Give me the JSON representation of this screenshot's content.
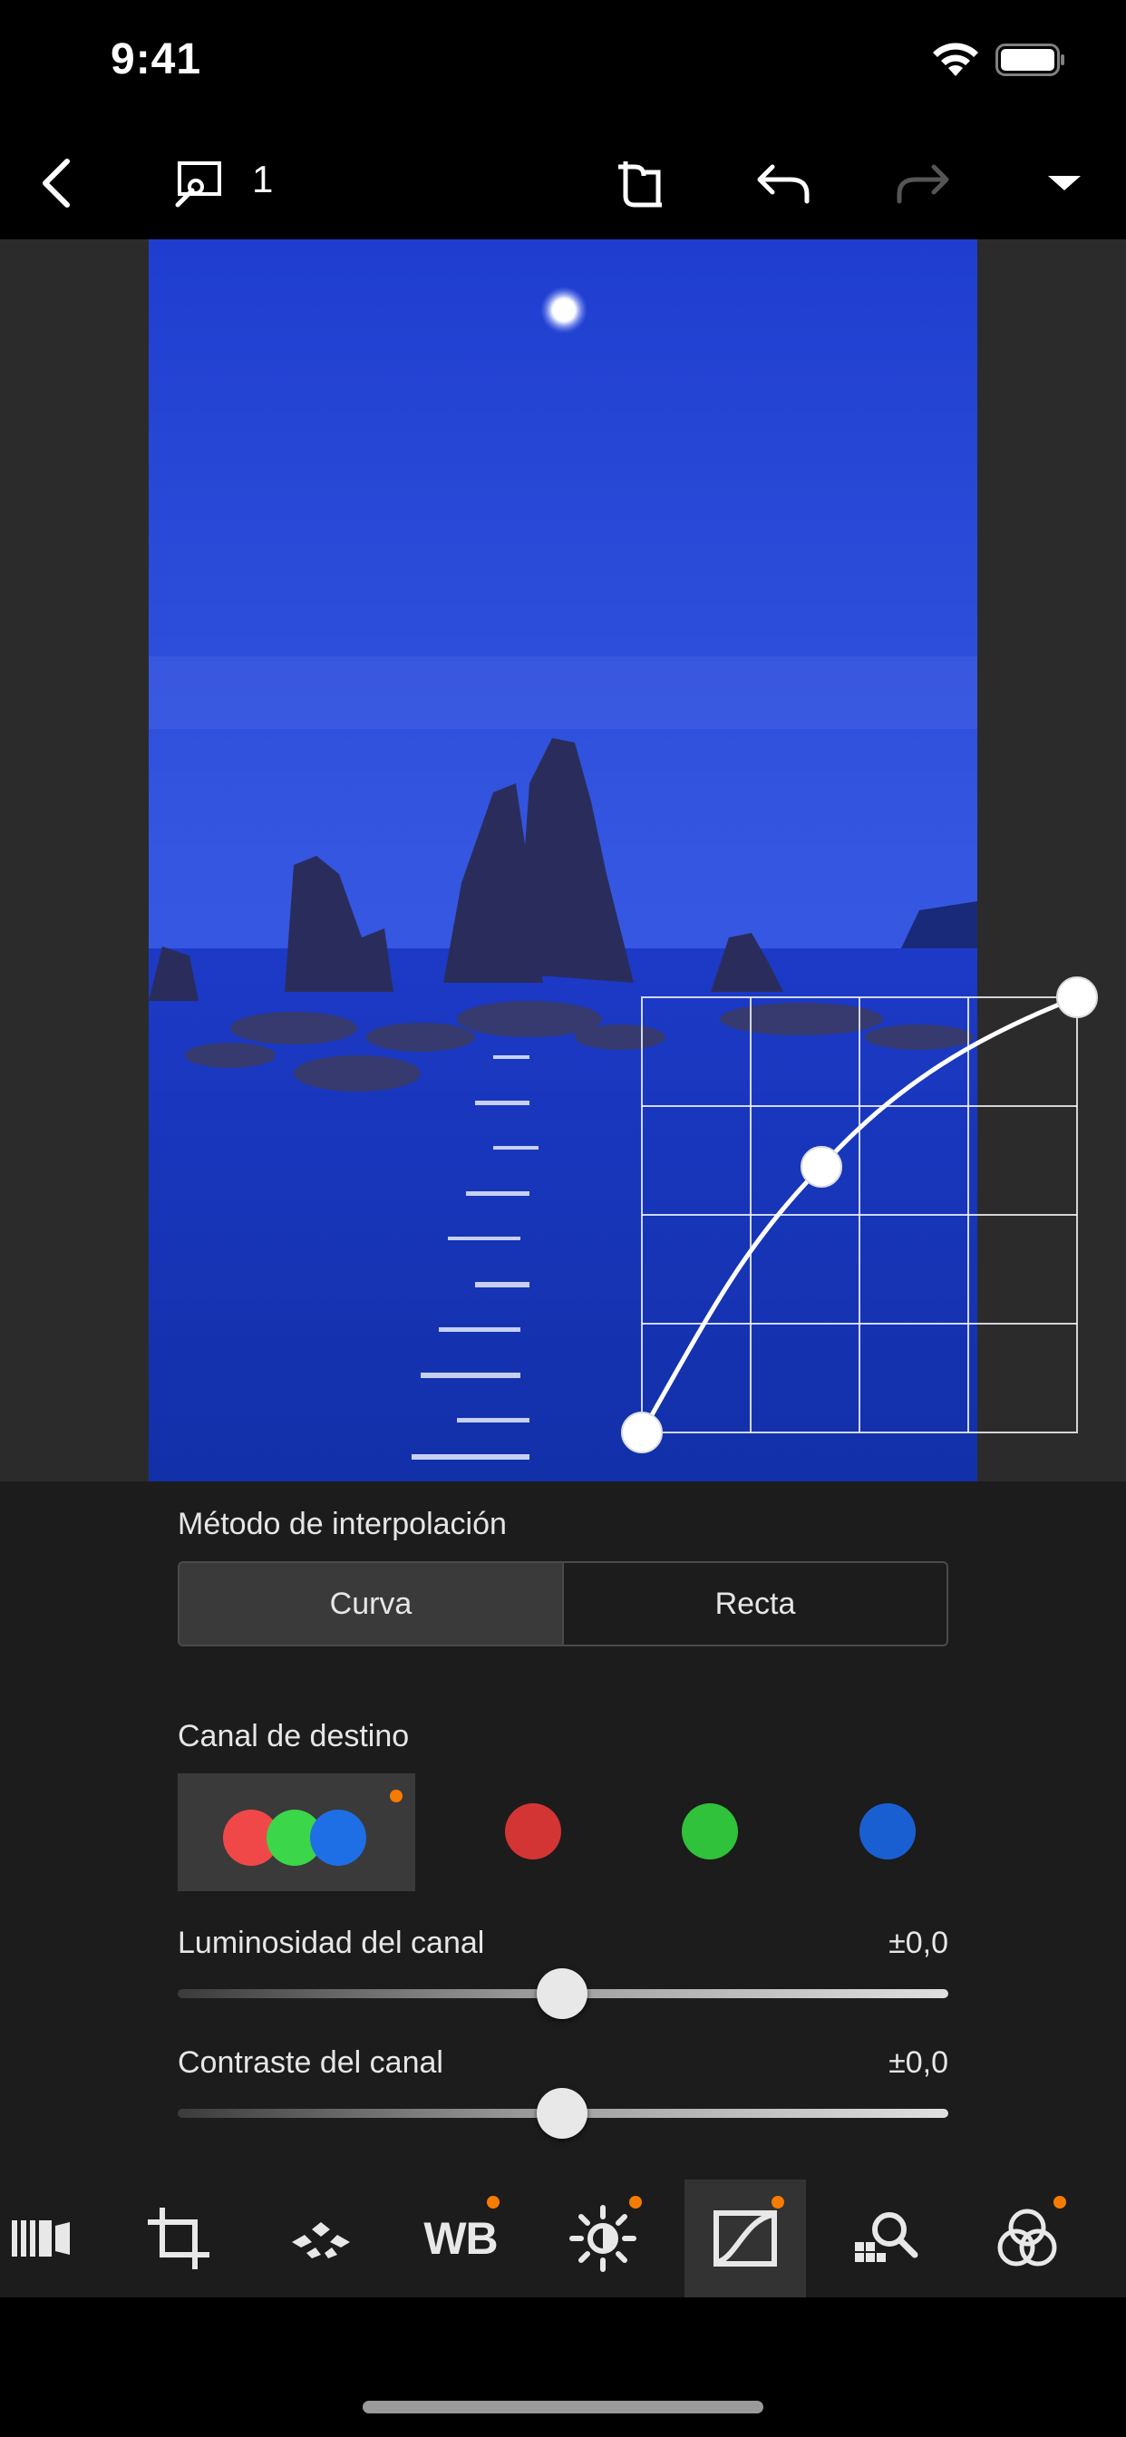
{
  "status_bar": {
    "time": "9:41",
    "icons": [
      "wifi-icon",
      "battery-icon"
    ]
  },
  "toolbar": {
    "icons": [
      "chevron-left-icon",
      "selection-tag-icon",
      "rotate-icon",
      "undo-icon",
      "redo-icon",
      "dropdown-triangle-icon"
    ],
    "selection_count": "1",
    "redo_enabled": false
  },
  "tone_curve": {
    "points": [
      [
        0,
        0
      ],
      [
        0.33,
        0.61
      ],
      [
        1,
        1
      ]
    ],
    "grid_divisions": 4
  },
  "panel": {
    "interpolation": {
      "label": "Método de interpolación",
      "options": [
        "Curva",
        "Recta"
      ],
      "selected": "Curva"
    },
    "channel": {
      "label": "Canal de destino",
      "options": [
        "rgb",
        "red",
        "green",
        "blue"
      ],
      "selected": "rgb",
      "colors": {
        "red": "#d33434",
        "green": "#2fc23a",
        "blue": "#1a5fd1",
        "rgb_red": "#f04848",
        "rgb_green": "#3bd64a",
        "rgb_blue": "#1e6fe6"
      },
      "modified_indicator_color": "#f57c00"
    },
    "sliders": [
      {
        "label": "Luminosidad del canal",
        "value": "±0,0",
        "position": 0.5
      },
      {
        "label": "Contraste del canal",
        "value": "±0,0",
        "position": 0.5
      }
    ]
  },
  "tools": {
    "items": [
      {
        "icon": "filmstrip-icon",
        "badge": false
      },
      {
        "icon": "crop-icon",
        "badge": false
      },
      {
        "icon": "picture-style-icon",
        "badge": false
      },
      {
        "icon": "white-balance-icon",
        "label": "WB",
        "badge": true
      },
      {
        "icon": "brightness-icon",
        "badge": true
      },
      {
        "icon": "tone-curve-icon",
        "badge": true,
        "active": true
      },
      {
        "icon": "lens-correction-icon",
        "badge": false
      },
      {
        "icon": "color-adjust-icon",
        "badge": true
      }
    ],
    "badge_color": "#f57c00"
  }
}
